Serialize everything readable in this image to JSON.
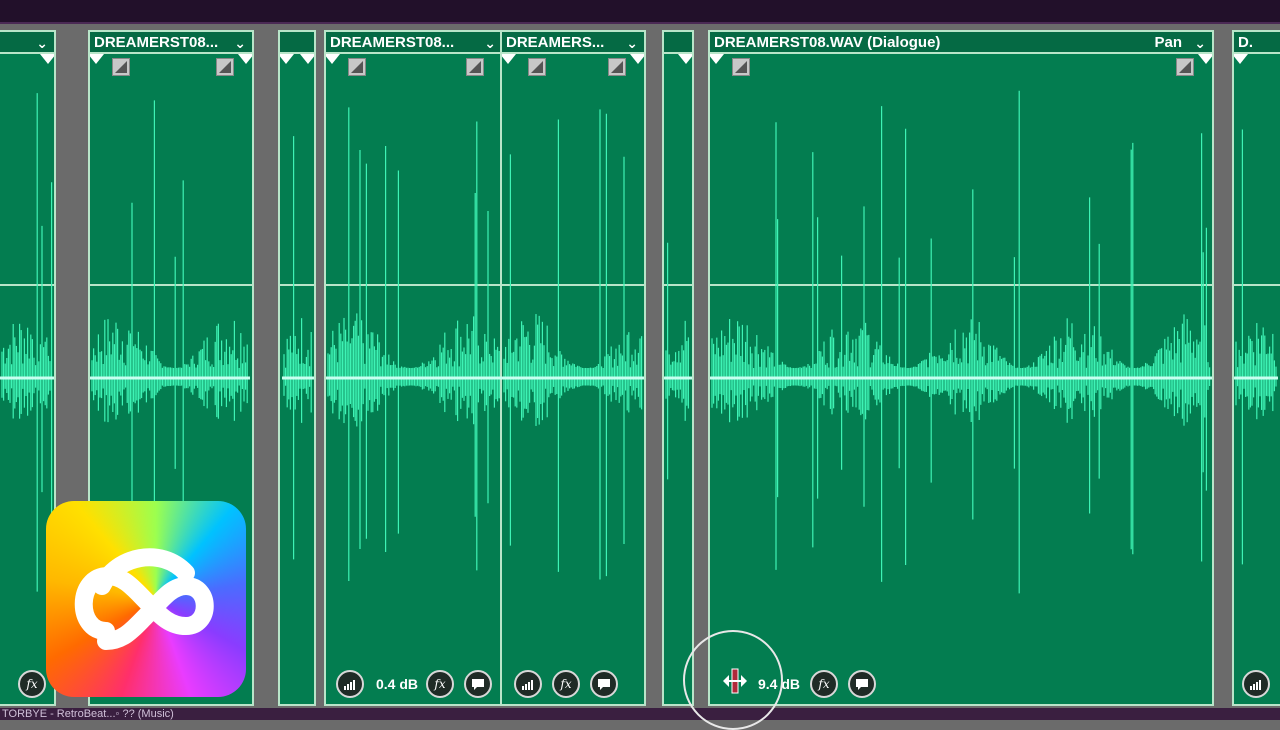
{
  "bottom_bar": {
    "text": "TORBYE - RetroBeat...◦ ?? (Music)"
  },
  "clips": [
    {
      "id": "c0",
      "title": "",
      "selected": false
    },
    {
      "id": "c1",
      "title": "DREAMERST08...",
      "selected": false
    },
    {
      "id": "c2",
      "title": "...",
      "selected": false
    },
    {
      "id": "c3",
      "title": "DREAMERST08...",
      "selected": false,
      "gain_label": "0.4 dB"
    },
    {
      "id": "c4",
      "title": "DREAMERS...",
      "selected": false
    },
    {
      "id": "c5",
      "title": "...",
      "selected": false
    },
    {
      "id": "c6",
      "title": "DREAMERST08.WAV (Dialogue)",
      "selected": true,
      "pan_label": "Pan",
      "gain_label": "9.4 dB"
    },
    {
      "id": "c7",
      "title": "D...",
      "selected": false
    }
  ],
  "icons": {
    "volume": "volume-meter-icon",
    "fx": "fx-icon",
    "comment": "comment-icon",
    "keyframe": "keyframe-icon",
    "dropdown": "chevron-down-icon",
    "move_cursor": "move-cursor-icon",
    "app_logo": "creative-cloud-logo"
  },
  "fx_label": "fx",
  "colors": {
    "clip_bg": "#037d50",
    "waveform": "#3ef3b5",
    "clip_border": "#b9e5c9",
    "timeline_bg": "#6b6b6b",
    "top_bar": "#22102a"
  }
}
